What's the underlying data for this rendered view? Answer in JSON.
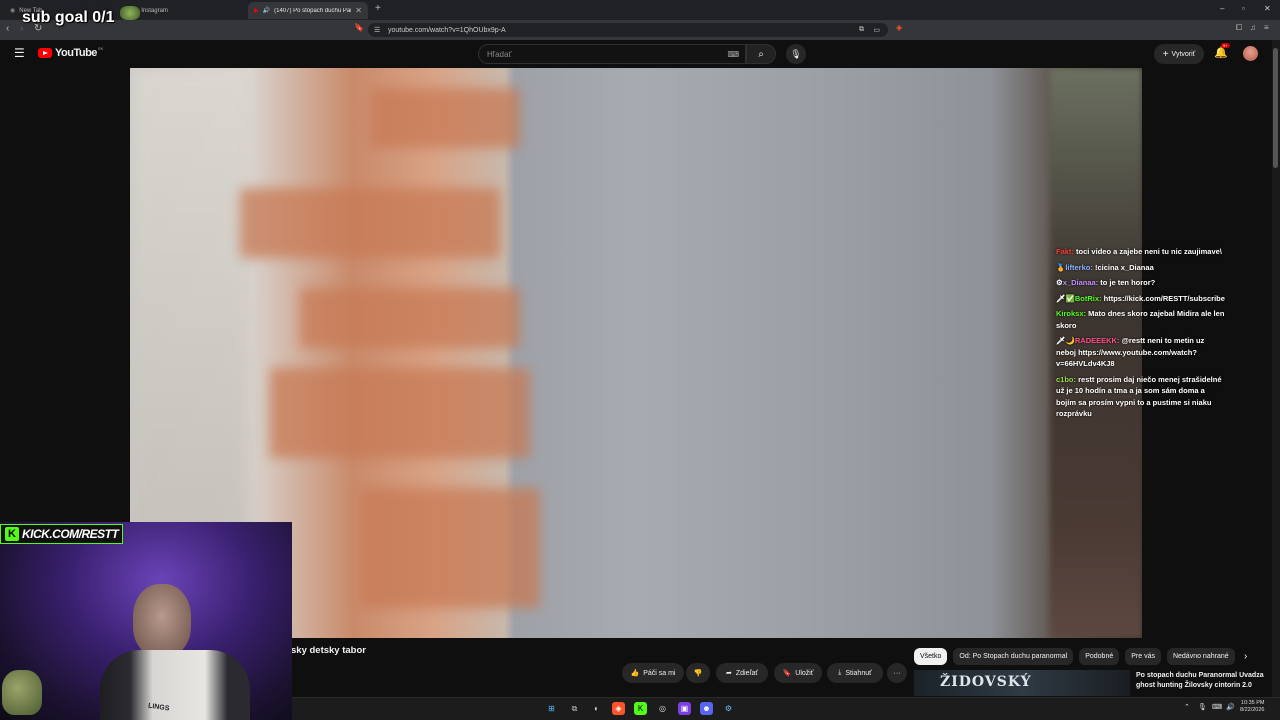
{
  "browser": {
    "tabs": [
      {
        "label": "New Tab"
      },
      {
        "label": "Instagram"
      },
      {
        "label": "(1407) Po stopach duchu Para...",
        "close": "✕"
      }
    ],
    "new_tab": "+",
    "url": "youtube.com/watch?v=1QhOUbx9p-A",
    "window_controls": [
      "–",
      "▫",
      "✕"
    ]
  },
  "youtube": {
    "logo_text": "YouTube",
    "region": "SK",
    "search_placeholder": "Hľadať",
    "create_label": "Vytvoriť",
    "notifications_badge": "9+"
  },
  "stream_overlay": {
    "sub_goal": "sub goal 0/1",
    "kick_url": "KICK.COM/RESTT",
    "webcam_shirt_text": "LINGS"
  },
  "chat": [
    {
      "user": "Fakt:",
      "text": "toci video a zajebe neni tu nic zaujimave\\",
      "color": "#ff3b3b"
    },
    {
      "user": "lifterko:",
      "text": "!cicina x_Dianaa",
      "color": "#8ab4ff"
    },
    {
      "user": "x_Dianaa:",
      "text": "to je ten horor?",
      "color": "#c38bff"
    },
    {
      "user": "BotRix:",
      "text": "https://kick.com/RESTT/subscribe",
      "color": "#53fc18"
    },
    {
      "user": "Kiroksx:",
      "text": "Mato dnes skoro zajebal Midira ale len skoro",
      "color": "#53fc18"
    },
    {
      "user": "RADEEEKK:",
      "text": "@restt neni to metin uz neboj https://www.youtube.com/watch?v=66HVLdv4KJ8",
      "color": "#ff4f8b"
    },
    {
      "user": "c1bo:",
      "text": "restt prosim daj niečo menej strašidelné už je 10 hodín a tma a ja som sám doma a bojím sa prosím vypni to a pustime si niaku rozprávku",
      "color": "#9ad94a"
    }
  ],
  "video": {
    "title_visible": "sky detsky tabor"
  },
  "actions": {
    "like": "Páči sa mi",
    "share": "Zdieľať",
    "save": "Uložiť",
    "download": "Stiahnuť",
    "more": "···"
  },
  "chips": [
    "Všetko",
    "Od: Po Stopach duchu paranormal",
    "Podobné",
    "Pre vás",
    "Nedávno nahrané"
  ],
  "recommendation": {
    "thumb_text": "ŽIDOVSKÝ",
    "title": "Po stopach duchu Paranormal Uvadza ghost hunting Žilovsky cintorin 2.0"
  },
  "taskbar": {
    "time": "10:35 PM",
    "date": "8/22/2026"
  }
}
